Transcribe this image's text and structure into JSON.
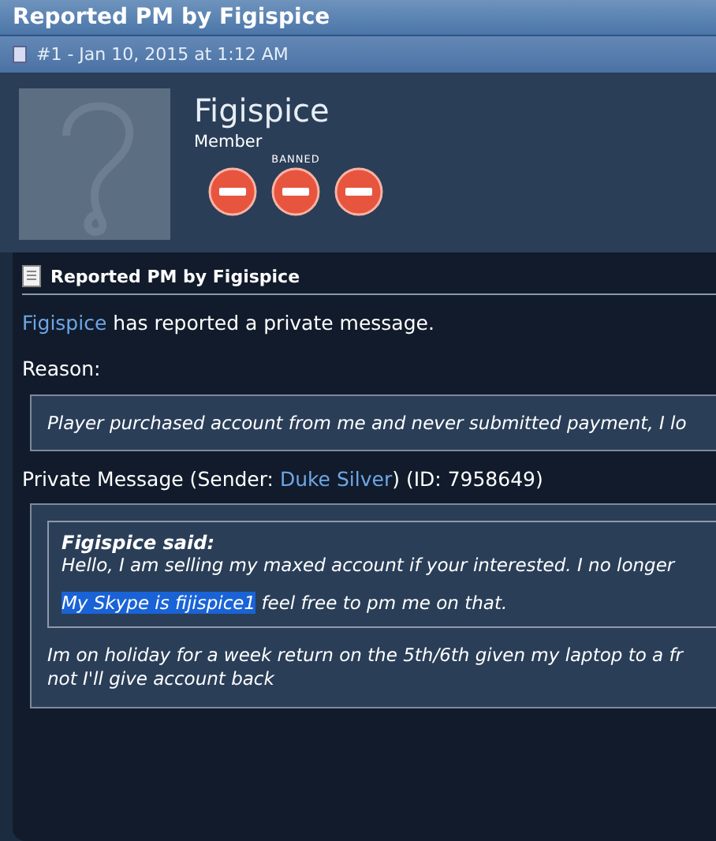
{
  "window": {
    "title": "Reported PM by Figispice"
  },
  "post": {
    "header": "#1 - Jan 10, 2015 at 1:12 AM"
  },
  "user": {
    "name": "Figispice",
    "title": "Member",
    "badges": [
      {
        "kind": "ban"
      },
      {
        "kind": "ban",
        "caption": "BANNED"
      },
      {
        "kind": "ban"
      }
    ]
  },
  "report": {
    "heading": "Reported PM by Figispice",
    "reporter": "Figispice",
    "reported_text": "has reported a private message.",
    "reason_label": "Reason:",
    "reason": "Player purchased account from me and never submitted payment, I lo",
    "pm_label_start": "Private Message (Sender: ",
    "sender": "Duke Silver",
    "pm_label_end": ") (ID: 7958649)",
    "quote": {
      "author": "Figispice said:",
      "line1": "Hello, I am selling my maxed account if your interested. I no longer",
      "line2": [
        {
          "text": "My Skype is fijispice1",
          "highlighted": true
        },
        {
          "text": " feel free to pm me on that.",
          "highlighted": false
        }
      ]
    },
    "message_lines": [
      "Im on holiday for a week return on the 5th/6th given my laptop to a fr",
      "not I'll give account back"
    ]
  }
}
